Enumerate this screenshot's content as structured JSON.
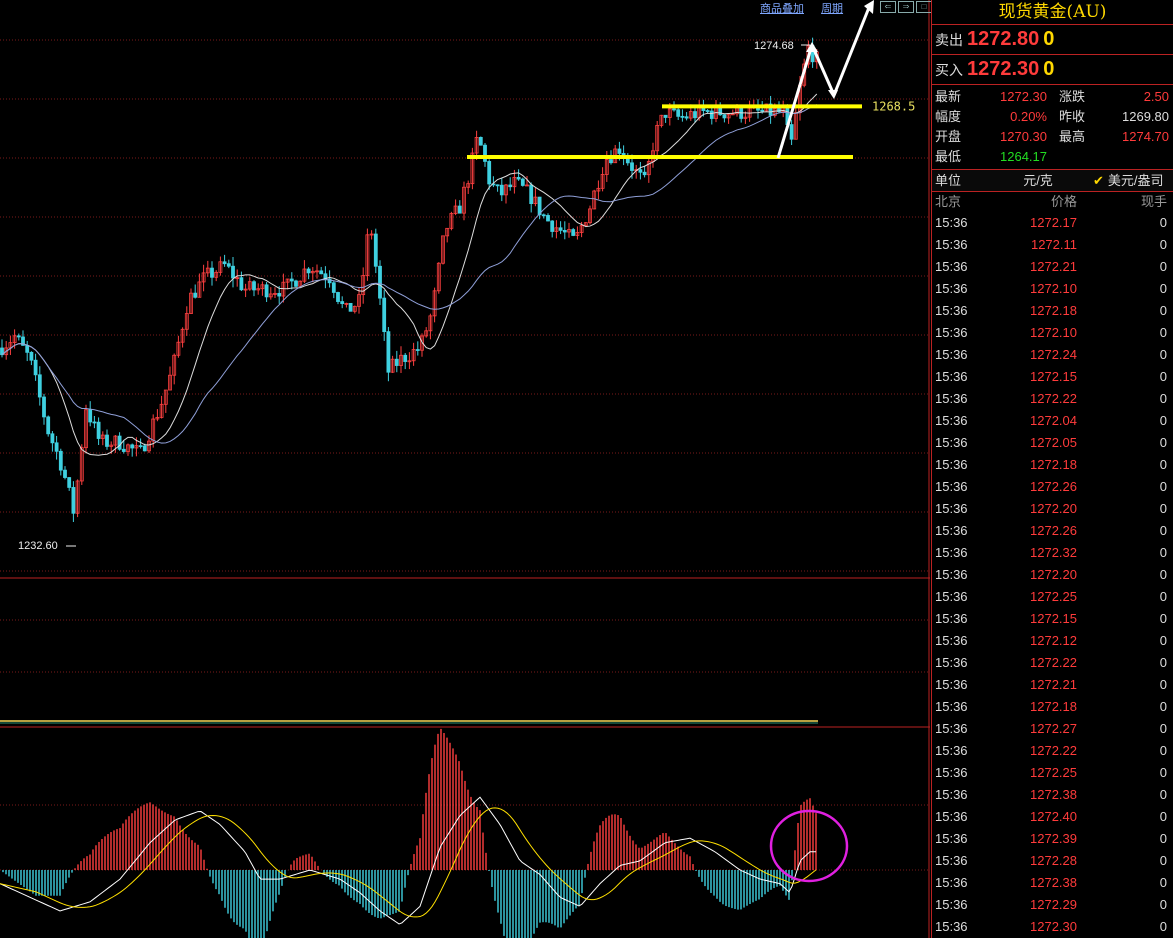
{
  "toolbar": {
    "overlay_label": "商品叠加",
    "period_label": "周期"
  },
  "panel": {
    "title": "现货黄金(AU)",
    "sell_label": "卖出",
    "sell_price": "1272.80",
    "sell_vol": "0",
    "buy_label": "买入",
    "buy_price": "1272.30",
    "buy_vol": "0",
    "stats": [
      {
        "k": "最新",
        "v": "1272.30",
        "k2": "涨跌",
        "v2": "2.50"
      },
      {
        "k": "幅度",
        "v": "0.20%",
        "k2": "昨收",
        "v2": "1269.80"
      },
      {
        "k": "开盘",
        "v": "1270.30",
        "k2": "最高",
        "v2": "1274.70"
      },
      {
        "k": "最低",
        "v": "1264.17",
        "k2": "",
        "v2": ""
      }
    ],
    "unit_label": "单位",
    "unit_value": "元/克",
    "unit_alt": "美元/盎司",
    "col_time": "北京",
    "col_price": "价格",
    "col_vol": "现手",
    "ticks": [
      {
        "t": "15:36",
        "p": "1272.17",
        "v": "0"
      },
      {
        "t": "15:36",
        "p": "1272.11",
        "v": "0"
      },
      {
        "t": "15:36",
        "p": "1272.21",
        "v": "0"
      },
      {
        "t": "15:36",
        "p": "1272.10",
        "v": "0"
      },
      {
        "t": "15:36",
        "p": "1272.18",
        "v": "0"
      },
      {
        "t": "15:36",
        "p": "1272.10",
        "v": "0"
      },
      {
        "t": "15:36",
        "p": "1272.24",
        "v": "0"
      },
      {
        "t": "15:36",
        "p": "1272.15",
        "v": "0"
      },
      {
        "t": "15:36",
        "p": "1272.22",
        "v": "0"
      },
      {
        "t": "15:36",
        "p": "1272.04",
        "v": "0"
      },
      {
        "t": "15:36",
        "p": "1272.05",
        "v": "0"
      },
      {
        "t": "15:36",
        "p": "1272.18",
        "v": "0"
      },
      {
        "t": "15:36",
        "p": "1272.26",
        "v": "0"
      },
      {
        "t": "15:36",
        "p": "1272.20",
        "v": "0"
      },
      {
        "t": "15:36",
        "p": "1272.26",
        "v": "0"
      },
      {
        "t": "15:36",
        "p": "1272.32",
        "v": "0"
      },
      {
        "t": "15:36",
        "p": "1272.20",
        "v": "0"
      },
      {
        "t": "15:36",
        "p": "1272.25",
        "v": "0"
      },
      {
        "t": "15:36",
        "p": "1272.15",
        "v": "0"
      },
      {
        "t": "15:36",
        "p": "1272.12",
        "v": "0"
      },
      {
        "t": "15:36",
        "p": "1272.22",
        "v": "0"
      },
      {
        "t": "15:36",
        "p": "1272.21",
        "v": "0"
      },
      {
        "t": "15:36",
        "p": "1272.18",
        "v": "0"
      },
      {
        "t": "15:36",
        "p": "1272.27",
        "v": "0"
      },
      {
        "t": "15:36",
        "p": "1272.22",
        "v": "0"
      },
      {
        "t": "15:36",
        "p": "1272.25",
        "v": "0"
      },
      {
        "t": "15:36",
        "p": "1272.38",
        "v": "0"
      },
      {
        "t": "15:36",
        "p": "1272.40",
        "v": "0"
      },
      {
        "t": "15:36",
        "p": "1272.39",
        "v": "0"
      },
      {
        "t": "15:36",
        "p": "1272.28",
        "v": "0"
      },
      {
        "t": "15:36",
        "p": "1272.38",
        "v": "0"
      },
      {
        "t": "15:36",
        "p": "1272.29",
        "v": "0"
      },
      {
        "t": "15:36",
        "p": "1272.30",
        "v": "0"
      }
    ]
  },
  "chart_data": {
    "type": "candlestick",
    "title": "",
    "ylim": [
      1229,
      1276.5
    ],
    "high_label": "1274.68",
    "low_label": "1232.60",
    "level_high": 1268.5,
    "level_high_label": "1268.5",
    "level_low": 1264.2,
    "waypoints": [
      [
        0,
        1248
      ],
      [
        15,
        1249
      ],
      [
        30,
        1247
      ],
      [
        48,
        1241
      ],
      [
        62,
        1238
      ],
      [
        74,
        1234
      ],
      [
        86,
        1243
      ],
      [
        100,
        1240
      ],
      [
        120,
        1240
      ],
      [
        140,
        1239
      ],
      [
        160,
        1243
      ],
      [
        172,
        1246
      ],
      [
        188,
        1252
      ],
      [
        205,
        1254
      ],
      [
        225,
        1255
      ],
      [
        245,
        1253
      ],
      [
        265,
        1253
      ],
      [
        285,
        1253
      ],
      [
        310,
        1255
      ],
      [
        330,
        1254
      ],
      [
        345,
        1251
      ],
      [
        360,
        1252
      ],
      [
        370,
        1259
      ],
      [
        380,
        1252
      ],
      [
        388,
        1246
      ],
      [
        400,
        1247
      ],
      [
        420,
        1248
      ],
      [
        432,
        1251
      ],
      [
        445,
        1258
      ],
      [
        460,
        1260
      ],
      [
        470,
        1263
      ],
      [
        478,
        1266
      ],
      [
        490,
        1262
      ],
      [
        500,
        1261
      ],
      [
        515,
        1262
      ],
      [
        530,
        1261
      ],
      [
        545,
        1259
      ],
      [
        560,
        1258
      ],
      [
        575,
        1257
      ],
      [
        590,
        1260
      ],
      [
        605,
        1264
      ],
      [
        620,
        1265
      ],
      [
        635,
        1263
      ],
      [
        645,
        1262
      ],
      [
        655,
        1266
      ],
      [
        665,
        1268
      ],
      [
        680,
        1267.5
      ],
      [
        700,
        1268
      ],
      [
        720,
        1268
      ],
      [
        740,
        1268
      ],
      [
        765,
        1268
      ],
      [
        780,
        1268
      ],
      [
        785,
        1268
      ],
      [
        790,
        1264.5
      ],
      [
        800,
        1270
      ],
      [
        808,
        1273.5
      ],
      [
        818,
        1272.3
      ]
    ],
    "macd_waypoints": [
      [
        0,
        -0.3
      ],
      [
        30,
        -0.6
      ],
      [
        60,
        -0.9
      ],
      [
        90,
        -0.7
      ],
      [
        120,
        -0.2
      ],
      [
        150,
        0.6
      ],
      [
        175,
        1.1
      ],
      [
        200,
        1.3
      ],
      [
        220,
        1.0
      ],
      [
        245,
        0.4
      ],
      [
        260,
        -0.2
      ],
      [
        280,
        -0.2
      ],
      [
        310,
        0.0
      ],
      [
        340,
        -0.2
      ],
      [
        360,
        -0.5
      ],
      [
        380,
        -0.9
      ],
      [
        400,
        -1.2
      ],
      [
        420,
        -0.8
      ],
      [
        440,
        0.5
      ],
      [
        460,
        1.2
      ],
      [
        480,
        1.6
      ],
      [
        500,
        1.0
      ],
      [
        520,
        0.2
      ],
      [
        540,
        -0.1
      ],
      [
        560,
        -0.6
      ],
      [
        580,
        -0.8
      ],
      [
        600,
        -0.3
      ],
      [
        620,
        0.1
      ],
      [
        640,
        0.2
      ],
      [
        665,
        0.6
      ],
      [
        690,
        0.7
      ],
      [
        715,
        0.4
      ],
      [
        740,
        0.0
      ],
      [
        760,
        -0.2
      ],
      [
        780,
        -0.3
      ],
      [
        790,
        -0.5
      ],
      [
        800,
        0.2
      ],
      [
        810,
        0.4
      ],
      [
        818,
        0.4
      ]
    ]
  }
}
